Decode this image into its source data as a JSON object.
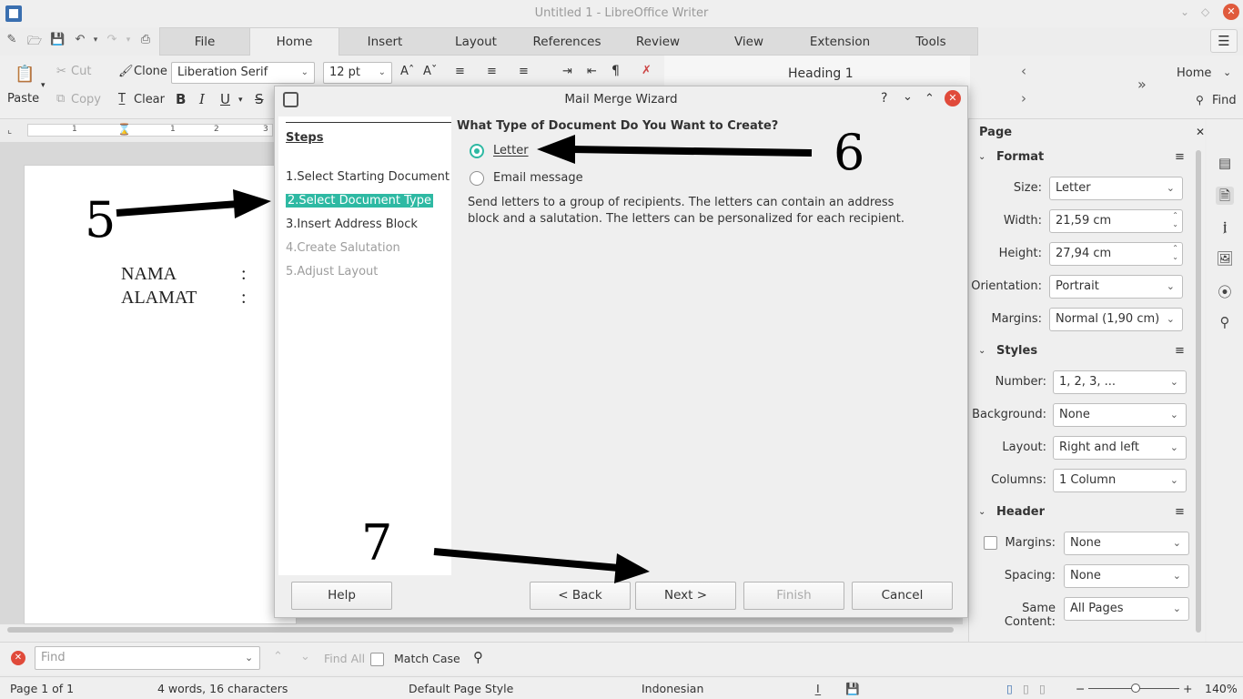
{
  "window": {
    "title": "Untitled 1 - LibreOffice Writer"
  },
  "tabs": [
    "File",
    "Home",
    "Insert",
    "Layout",
    "References",
    "Review",
    "View",
    "Extension",
    "Tools"
  ],
  "toolbar": {
    "paste": "Paste",
    "cut": "Cut",
    "copy": "Copy",
    "clone": "Clone",
    "clear": "Clear",
    "font_name": "Liberation Serif",
    "font_size": "12 pt",
    "bold": "B",
    "italic": "I",
    "underline": "U",
    "strike": "S",
    "paragraph_style": "Heading 1",
    "home": "Home",
    "find": "Find"
  },
  "document": {
    "line1_label": "NAMA",
    "line1_colon": ":",
    "line2_label": "ALAMAT",
    "line2_colon": ":",
    "ruler_nums": [
      "1",
      "1",
      "2",
      "3"
    ]
  },
  "dialog": {
    "title": "Mail Merge Wizard",
    "steps_heading": "Steps",
    "steps": [
      "1.Select Starting Document",
      "2.Select Document Type",
      "3.Insert Address Block",
      "4.Create Salutation",
      "5.Adjust Layout"
    ],
    "question": "What Type of Document Do You Want to Create?",
    "option_letter": "Letter",
    "option_email": "Email message",
    "description": "Send letters to a group of recipients. The letters can contain an address block and a salutation. The letters can be personalized for each recipient.",
    "buttons": {
      "help": "Help",
      "back": "< Back",
      "next": "Next >",
      "finish": "Finish",
      "cancel": "Cancel"
    },
    "title_controls": {
      "help": "?"
    }
  },
  "annotations": [
    "5",
    "6",
    "7"
  ],
  "sidebar": {
    "title": "Page",
    "format_heading": "Format",
    "size_label": "Size:",
    "size_value": "Letter",
    "width_label": "Width:",
    "width_value": "21,59 cm",
    "height_label": "Height:",
    "height_value": "27,94 cm",
    "orientation_label": "Orientation:",
    "orientation_value": "Portrait",
    "margins_label": "Margins:",
    "margins_value": "Normal (1,90 cm)",
    "styles_heading": "Styles",
    "number_label": "Number:",
    "number_value": "1, 2, 3, ...",
    "background_label": "Background:",
    "background_value": "None",
    "layout_label": "Layout:",
    "layout_value": "Right and left",
    "columns_label": "Columns:",
    "columns_value": "1 Column",
    "header_heading": "Header",
    "h_margins_label": "Margins:",
    "h_margins_value": "None",
    "h_spacing_label": "Spacing:",
    "h_spacing_value": "None",
    "h_same_label": "Same Content:",
    "h_same_value": "All Pages"
  },
  "findbar": {
    "placeholder": "Find",
    "find_all": "Find All",
    "match_case": "Match Case"
  },
  "statusbar": {
    "page": "Page 1 of 1",
    "words": "4 words, 16 characters",
    "page_style": "Default Page Style",
    "language": "Indonesian",
    "zoom": "140%"
  }
}
